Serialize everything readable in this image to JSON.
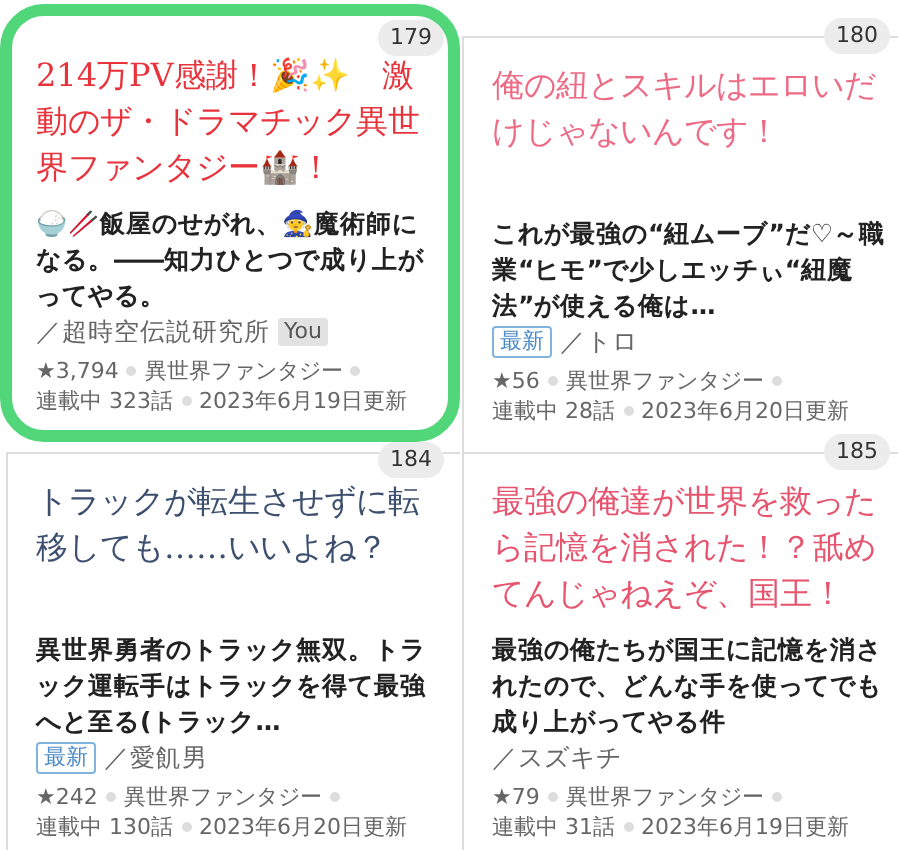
{
  "cards": [
    {
      "rank": "179",
      "highlighted": true,
      "catch": "214万PV感謝！🎉✨　激動のザ・ドラマチック異世界ファンタジー🏰！",
      "color": "#e8333c",
      "title": "🍚🥢飯屋のせがれ、🧙魔術師になる。――知力ひとつで成り上がってやる。",
      "author": "／超時空伝説研究所",
      "tag": {
        "kind": "you",
        "label": "You"
      },
      "stars": "★3,794",
      "genre": "異世界ファンタジー",
      "status": "連載中 323話",
      "date": "2023年6月19日更新"
    },
    {
      "rank": "180",
      "highlighted": false,
      "catch": "俺の紐とスキルはエロいだけじゃないんです！",
      "color": "#ee6b86",
      "title": "これが最強の“紐ムーブ”だ♡～職業“ヒモ”で少しエッチぃ“紐魔法”が使える俺は…",
      "author": "／トロ",
      "tag": {
        "kind": "new",
        "label": "最新"
      },
      "stars": "★56",
      "genre": "異世界ファンタジー",
      "status": "連載中 28話",
      "date": "2023年6月20日更新"
    },
    {
      "rank": "184",
      "highlighted": false,
      "catch": "トラックが転生させずに転移しても……いいよね？",
      "color": "#3d4f6e",
      "title": "異世界勇者のトラック無双。トラック運転手はトラックを得て最強へと至る(トラック…",
      "author": "／愛飢男",
      "tag": {
        "kind": "new",
        "label": "最新"
      },
      "stars": "★242",
      "genre": "異世界ファンタジー",
      "status": "連載中 130話",
      "date": "2023年6月20日更新"
    },
    {
      "rank": "185",
      "highlighted": false,
      "catch": "最強の俺達が世界を救ったら記憶を消された！？舐めてんじゃねえぞ、国王！",
      "color": "#e6546e",
      "title": "最強の俺たちが国王に記憶を消されたので、どんな手を使ってでも成り上がってやる件",
      "author": "／スズキチ",
      "stars": "★79",
      "genre": "異世界ファンタジー",
      "status": "連載中 31話",
      "date": "2023年6月19日更新"
    }
  ]
}
